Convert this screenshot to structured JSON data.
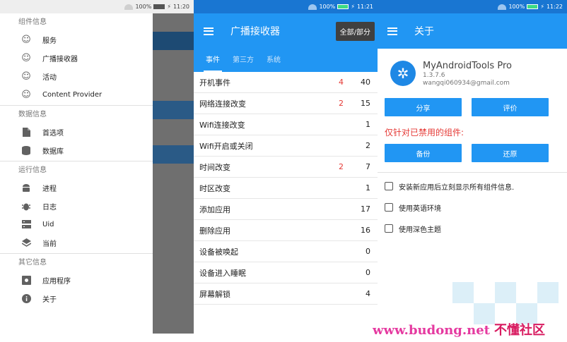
{
  "panel1": {
    "status": {
      "battery": "100%",
      "time": "11:20"
    },
    "sections": [
      {
        "title": "组件信息",
        "items": [
          {
            "label": "服务",
            "icon": "smiley-icon"
          },
          {
            "label": "广播接收器",
            "icon": "smiley-icon"
          },
          {
            "label": "活动",
            "icon": "smiley-icon"
          },
          {
            "label": "Content Provider",
            "icon": "smiley-icon"
          }
        ]
      },
      {
        "title": "数据信息",
        "items": [
          {
            "label": "首选项",
            "icon": "file-icon"
          },
          {
            "label": "数据库",
            "icon": "database-icon"
          }
        ]
      },
      {
        "title": "运行信息",
        "items": [
          {
            "label": "进程",
            "icon": "android-icon"
          },
          {
            "label": "日志",
            "icon": "bug-icon"
          },
          {
            "label": "Uid",
            "icon": "server-icon"
          },
          {
            "label": "当前",
            "icon": "layers-icon"
          }
        ]
      },
      {
        "title": "其它信息",
        "items": [
          {
            "label": "应用程序",
            "icon": "app-settings-icon"
          },
          {
            "label": "关于",
            "icon": "info-icon"
          }
        ]
      }
    ]
  },
  "panel2": {
    "status": {
      "battery": "100%",
      "time": "11:21"
    },
    "title": "广播接收器",
    "toggle_label": "全部/部分",
    "tabs": [
      {
        "label": "事件"
      },
      {
        "label": "第三方"
      },
      {
        "label": "系统"
      }
    ],
    "events": [
      {
        "name": "开机事件",
        "disabled": "4",
        "count": "40"
      },
      {
        "name": "网络连接改变",
        "disabled": "2",
        "count": "15"
      },
      {
        "name": "Wifi连接改变",
        "disabled": "",
        "count": "1"
      },
      {
        "name": "Wifi开启或关闭",
        "disabled": "",
        "count": "2"
      },
      {
        "name": "时间改变",
        "disabled": "2",
        "count": "7"
      },
      {
        "name": "时区改变",
        "disabled": "",
        "count": "1"
      },
      {
        "name": "添加应用",
        "disabled": "",
        "count": "17"
      },
      {
        "name": "删除应用",
        "disabled": "",
        "count": "16"
      },
      {
        "name": "设备被唤起",
        "disabled": "",
        "count": "0"
      },
      {
        "name": "设备进入睡眠",
        "disabled": "",
        "count": "0"
      },
      {
        "name": "屏幕解锁",
        "disabled": "",
        "count": "4"
      }
    ]
  },
  "panel3": {
    "status": {
      "battery": "100%",
      "time": "11:22"
    },
    "title": "关于",
    "app_name": "MyAndroidTools Pro",
    "version": "1.3.7.6",
    "email": "wangqi060934@gmail.com",
    "share_label": "分享",
    "rate_label": "评价",
    "disabled_heading": "仅针对已禁用的组件:",
    "backup_label": "备份",
    "restore_label": "还原",
    "options": [
      {
        "label": "安装新应用后立刻显示所有组件信息."
      },
      {
        "label": "使用英语环境"
      },
      {
        "label": "使用深色主题"
      }
    ]
  },
  "watermark": {
    "url": "www.budong.net",
    "cn": "不懂社区"
  },
  "colors": {
    "primary": "#2196f3",
    "status_bar": "#1976d2",
    "accent_red": "#e53935"
  }
}
